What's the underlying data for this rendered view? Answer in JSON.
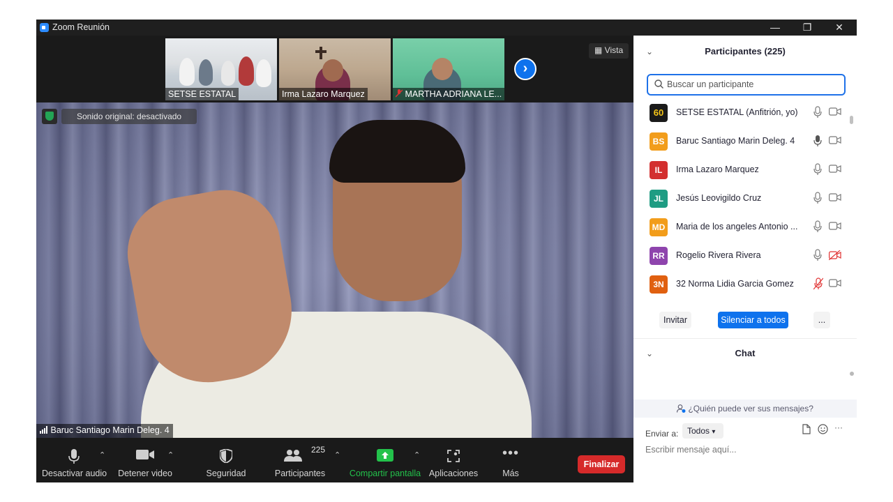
{
  "window": {
    "title": "Zoom Reunión",
    "minimize": "—",
    "restore": "❐",
    "close": "✕"
  },
  "strip": {
    "thumbnails": [
      {
        "name": "SETSE ESTATAL"
      },
      {
        "name": "Irma Lazaro Marquez"
      },
      {
        "name": "MARTHA ADRIANA LE..."
      }
    ],
    "next_glyph": "›",
    "view_label": "Vista"
  },
  "main_video": {
    "sound_status": "Sonido original: desactivado",
    "speaker_name": "Baruc Santiago Marin Deleg. 4"
  },
  "toolbar": {
    "mute": "Desactivar audio",
    "video": "Detener video",
    "security": "Seguridad",
    "participants": "Participantes",
    "participants_count": "225",
    "share": "Compartir pantalla",
    "apps": "Aplicaciones",
    "more": "Más",
    "end": "Finalizar"
  },
  "participants_panel": {
    "title": "Participantes (225)",
    "search_placeholder": "Buscar un participante",
    "list": [
      {
        "initials": "60",
        "name": "SETSE ESTATAL (Anfitrión, yo)",
        "color": "#1a1a1a",
        "mic_muted": false,
        "cam_off": false
      },
      {
        "initials": "BS",
        "name": "Baruc Santiago Marin Deleg. 4",
        "color": "#f29d1b",
        "mic_muted": false,
        "cam_off": false
      },
      {
        "initials": "IL",
        "name": "Irma Lazaro Marquez",
        "color": "#d32f2f",
        "mic_muted": false,
        "cam_off": false
      },
      {
        "initials": "JL",
        "name": "Jesús Leovigildo Cruz",
        "color": "#1f9c83",
        "mic_muted": false,
        "cam_off": false
      },
      {
        "initials": "MD",
        "name": "Maria de los angeles Antonio ...",
        "color": "#f29d1b",
        "mic_muted": false,
        "cam_off": false
      },
      {
        "initials": "RR",
        "name": "Rogelio Rivera Rivera",
        "color": "#8e44ad",
        "mic_muted": false,
        "cam_off": true
      },
      {
        "initials": "3N",
        "name": "32 Norma Lidia Garcia Gomez",
        "color": "#e06010",
        "mic_muted": true,
        "cam_off": false
      }
    ],
    "invite": "Invitar",
    "mute_all": "Silenciar a todos",
    "more": "..."
  },
  "chat_panel": {
    "title": "Chat",
    "who_can_see": "¿Quién puede ver sus mensajes?",
    "send_to_label": "Enviar a:",
    "send_to_value": "Todos",
    "input_placeholder": "Escribir mensaje aquí..."
  },
  "colors": {
    "accent": "#0e72ed",
    "end_red": "#d62a2a",
    "share_green": "#23c24b"
  }
}
